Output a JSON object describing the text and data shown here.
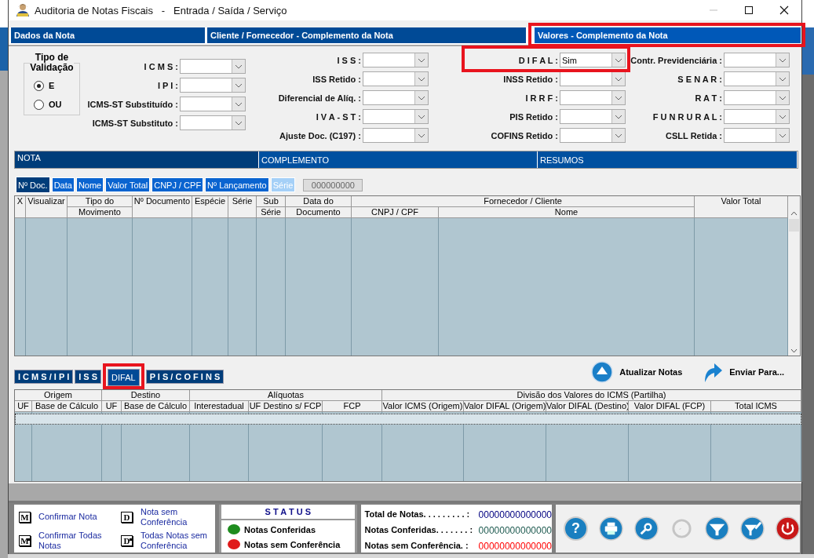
{
  "window": {
    "title": "Auditoria de Notas Fiscais   -   Entrada / Saída / Serviço"
  },
  "sections": [
    {
      "label": "Dados da Nota",
      "selected": false,
      "highlighted": false
    },
    {
      "label": "Cliente / Fornecedor - Complemento da Nota",
      "selected": false,
      "highlighted": false
    },
    {
      "label": "Valores - Complemento da Nota",
      "selected": true,
      "highlighted": true
    }
  ],
  "validation": {
    "title": "Tipo de Validação",
    "options": [
      {
        "label": "E",
        "selected": true
      },
      {
        "label": "OU",
        "selected": false
      }
    ]
  },
  "filter_columns": [
    [
      {
        "label": "I C M S :",
        "highlighted": false
      },
      {
        "label": "I P I :",
        "highlighted": false
      },
      {
        "label": "ICMS-ST Substituído :",
        "highlighted": false
      },
      {
        "label": "ICMS-ST Substituto :",
        "highlighted": false
      }
    ],
    [
      {
        "label": "I S S :",
        "highlighted": false
      },
      {
        "label": "ISS Retido :",
        "highlighted": false
      },
      {
        "label": "Diferencial de Alíq. :",
        "highlighted": false
      },
      {
        "label": "I V A - S T :",
        "highlighted": false
      },
      {
        "label": "Ajuste Doc. (C197) :",
        "highlighted": false
      }
    ],
    [
      {
        "label": "D I F A L :",
        "value": "Sim",
        "highlighted": true
      },
      {
        "label": "INSS Retido :",
        "highlighted": false
      },
      {
        "label": "I R R F :",
        "highlighted": false
      },
      {
        "label": "PIS Retido :",
        "highlighted": false
      },
      {
        "label": "COFINS Retido :",
        "highlighted": false
      }
    ],
    [
      {
        "label": "Contr. Previdenciária :",
        "highlighted": false
      },
      {
        "label": "S E N A R :",
        "highlighted": false
      },
      {
        "label": "R A T :",
        "highlighted": false
      },
      {
        "label": "F U N R U R A L :",
        "highlighted": false
      },
      {
        "label": "CSLL Retida :",
        "highlighted": false
      }
    ]
  ],
  "panel_tabs": [
    {
      "label": "NOTA",
      "selected": true
    },
    {
      "label": "COMPLEMENTO",
      "selected": false
    },
    {
      "label": "RESUMOS",
      "selected": false
    }
  ],
  "sort_buttons": [
    {
      "label": "Nº Doc.",
      "selected": true,
      "disabled": false
    },
    {
      "label": "Data",
      "selected": false,
      "disabled": false
    },
    {
      "label": "Nome",
      "selected": false,
      "disabled": false
    },
    {
      "label": "Valor Total",
      "selected": false,
      "disabled": false
    },
    {
      "label": "CNPJ / CPF",
      "selected": false,
      "disabled": false
    },
    {
      "label": "Nº Lançamento",
      "selected": false,
      "disabled": false
    },
    {
      "label": "Série",
      "selected": false,
      "disabled": true
    }
  ],
  "sort_counter": "000000000",
  "notes_table": {
    "columns": [
      {
        "label": "X"
      },
      {
        "label": "Visualizar"
      },
      {
        "label": "Tipo do",
        "sub_label": "Movimento"
      },
      {
        "label": "Nº Documento"
      },
      {
        "label": "Espécie"
      },
      {
        "label": "Série"
      },
      {
        "label": "Sub",
        "sub_label": "Série"
      },
      {
        "label": "Data do",
        "sub_label": "Documento"
      },
      {
        "label": "Fornecedor / Cliente",
        "children": [
          {
            "label": "CNPJ / CPF"
          },
          {
            "label": "Nome"
          }
        ]
      },
      {
        "label": "Valor Total"
      }
    ]
  },
  "detail_tabs": [
    {
      "label": "I C M S / I P I",
      "selected": false,
      "highlighted": false
    },
    {
      "label": "I S S",
      "selected": false,
      "highlighted": false
    },
    {
      "label": "DIFAL",
      "selected": true,
      "highlighted": true
    },
    {
      "label": "P I S / C O F I N S",
      "selected": false,
      "highlighted": false
    }
  ],
  "actions": [
    {
      "label": "Atualizar Notas",
      "kind": "refresh"
    },
    {
      "label": "Enviar Para...",
      "kind": "send"
    }
  ],
  "difal_table": {
    "columns": [
      {
        "label": "Origem",
        "children": [
          {
            "label": "UF"
          },
          {
            "label": "Base de Cálculo"
          }
        ]
      },
      {
        "label": "Destino",
        "children": [
          {
            "label": "UF"
          },
          {
            "label": "Base de Cálculo"
          }
        ]
      },
      {
        "label": "Alíquotas",
        "children": [
          {
            "label": "Interestadual"
          },
          {
            "label": "UF Destino s/ FCP"
          },
          {
            "label": "FCP"
          }
        ]
      },
      {
        "label": "Divisão dos Valores do ICMS (Partilha)",
        "children": [
          {
            "label": "Valor ICMS (Origem)"
          },
          {
            "label": "Valor DIFAL (Origem)"
          },
          {
            "label": "Valor DIFAL (Destino)"
          },
          {
            "label": "Valor DIFAL (FCP)"
          },
          {
            "label": "Total ICMS"
          }
        ]
      }
    ]
  },
  "legend": [
    {
      "key": "M",
      "plus": false,
      "label": "Confirmar Nota"
    },
    {
      "key": "D",
      "plus": false,
      "label": "Nota sem Conferência"
    },
    {
      "key": "M",
      "plus": true,
      "label": "Confirmar Todas Notas"
    },
    {
      "key": "D",
      "plus": true,
      "label": "Todas Notas sem Conferência"
    }
  ],
  "status": {
    "title": "S T A T U S",
    "items": [
      {
        "label": "Notas Conferidas",
        "color": "#1e8c1e"
      },
      {
        "label": "Notas sem Conferência",
        "color": "#e01a1a"
      }
    ]
  },
  "totals": [
    {
      "label": "Total de Notas. . . . . . . . . :",
      "value": "00000000000000",
      "color": "#000080"
    },
    {
      "label": "Notas Conferidas. . . . . . . :",
      "value": "00000000000000",
      "color": "#1e5a50"
    },
    {
      "label": "Notas sem Conferência. :",
      "value": "00000000000000",
      "color": "#ff0000"
    }
  ],
  "toolbar": [
    {
      "kind": "help",
      "glyph": "?",
      "disabled": false
    },
    {
      "kind": "print",
      "disabled": false
    },
    {
      "kind": "search",
      "disabled": false
    },
    {
      "kind": "loading",
      "disabled": true
    },
    {
      "kind": "filter",
      "disabled": false
    },
    {
      "kind": "filter-clear",
      "disabled": false
    },
    {
      "kind": "power",
      "disabled": false
    }
  ]
}
